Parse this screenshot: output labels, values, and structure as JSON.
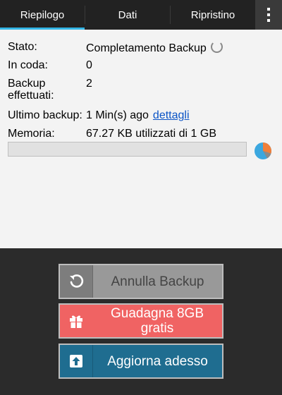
{
  "tabs": [
    {
      "label": "Riepilogo",
      "active": true
    },
    {
      "label": "Dati",
      "active": false
    },
    {
      "label": "Ripristino",
      "active": false
    }
  ],
  "menu": {
    "icon": "overflow-menu-icon"
  },
  "summary": {
    "status_label": "Stato:",
    "status_value": "Completamento Backup",
    "queue_label": "In coda:",
    "queue_value": "0",
    "done_label": "Backup effettuati:",
    "done_value": "2",
    "last_label": "Ultimo backup:",
    "last_value": "1 Min(s) ago",
    "details_link": "dettagli",
    "memory_label": "Memoria:",
    "memory_value": "67.27 KB utilizzati di 1 GB",
    "memory_used_fraction": 0.0001
  },
  "buttons": {
    "cancel_label": "Annulla Backup",
    "earn_label": "Guadagna 8GB gratis",
    "upgrade_label": "Aggiorna adesso"
  },
  "colors": {
    "accent": "#33b5e5",
    "earn_button": "#f06363",
    "upgrade_button": "#1f6d90",
    "cancel_button": "#999999",
    "pie_blue": "#3ba7df",
    "pie_orange": "#f07f3a"
  }
}
